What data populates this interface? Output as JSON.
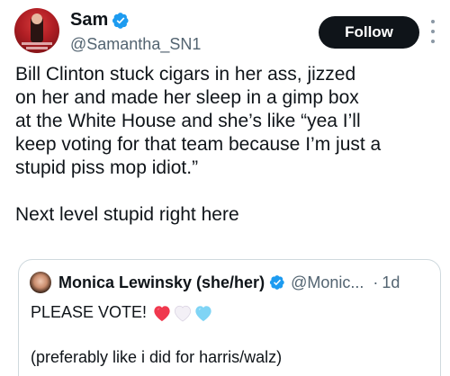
{
  "author": {
    "display_name": "Sam",
    "handle": "@Samantha_SN1",
    "verified": true
  },
  "follow_button": {
    "label": "Follow"
  },
  "tweet": {
    "lines": [
      "Bill Clinton stuck cigars in her ass, jizzed",
      "on her and made her sleep in a gimp box",
      "at the White House and she’s like “yea I’ll",
      "keep voting for that team because I’m just a",
      "stupid piss mop idiot.”"
    ],
    "closing_line": "Next level stupid right here"
  },
  "quoted_tweet": {
    "display_name": "Monica Lewinsky (she/her)",
    "verified": true,
    "handle": "@Monic...",
    "separator": "·",
    "timestamp": "1d",
    "line1": "PLEASE VOTE!",
    "emojis": [
      "red-heart",
      "white-heart",
      "light-blue-heart"
    ],
    "line2": "(preferably like i did for harris/walz)"
  },
  "colors": {
    "verified_blue": "#1d9bf0",
    "text_primary": "#0f1419",
    "text_secondary": "#536471",
    "follow_bg": "#0f1419",
    "heart_red": "#f0384e",
    "heart_white": "#f3f0f6",
    "heart_blue": "#7fd4f5"
  }
}
